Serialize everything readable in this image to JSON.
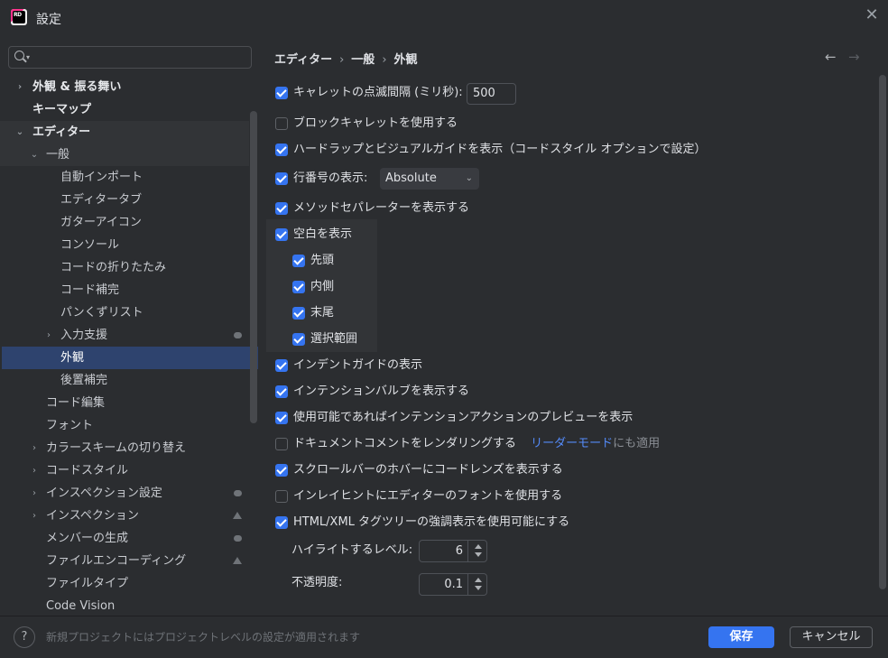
{
  "window": {
    "title": "設定",
    "app_logo_text": "RD"
  },
  "search": {
    "placeholder": ""
  },
  "tree": [
    {
      "label": "外観 & 振る舞い"
    },
    {
      "label": "キーマップ"
    },
    {
      "label": "エディター"
    },
    {
      "label": "一般"
    },
    {
      "label": "自動インポート"
    },
    {
      "label": "エディタータブ"
    },
    {
      "label": "ガターアイコン"
    },
    {
      "label": "コンソール"
    },
    {
      "label": "コードの折りたたみ"
    },
    {
      "label": "コード補完"
    },
    {
      "label": "パンくずリスト"
    },
    {
      "label": "入力支援"
    },
    {
      "label": "外観"
    },
    {
      "label": "後置補完"
    },
    {
      "label": "コード編集"
    },
    {
      "label": "フォント"
    },
    {
      "label": "カラースキームの切り替え"
    },
    {
      "label": "コードスタイル"
    },
    {
      "label": "インスペクション設定"
    },
    {
      "label": "インスペクション"
    },
    {
      "label": "メンバーの生成"
    },
    {
      "label": "ファイルエンコーディング"
    },
    {
      "label": "ファイルタイプ"
    },
    {
      "label": "Code Vision"
    }
  ],
  "breadcrumb": [
    "エディター",
    "一般",
    "外観"
  ],
  "options": {
    "caret_blink": {
      "label": "キャレットの点滅間隔 (ミリ秒):",
      "value": "500",
      "checked": true
    },
    "block_caret": {
      "label": "ブロックキャレットを使用する",
      "checked": false
    },
    "hard_wraps": {
      "label": "ハードラップとビジュアルガイドを表示（コードスタイル オプションで設定）",
      "checked": true
    },
    "line_numbers": {
      "label": "行番号の表示:",
      "value": "Absolute",
      "checked": true
    },
    "method_sep": {
      "label": "メソッドセパレーターを表示する",
      "checked": true
    },
    "whitespace": {
      "label": "空白を表示",
      "checked": true
    },
    "ws_leading": {
      "label": "先頭",
      "checked": true
    },
    "ws_inner": {
      "label": "内側",
      "checked": true
    },
    "ws_trailing": {
      "label": "末尾",
      "checked": true
    },
    "ws_selection": {
      "label": "選択範囲",
      "checked": true
    },
    "indent_guides": {
      "label": "インデントガイドの表示",
      "checked": true
    },
    "intention_bulb": {
      "label": "インテンションバルブを表示する",
      "checked": true
    },
    "intention_preview": {
      "label": "使用可能であればインテンションアクションのプレビューを表示",
      "checked": true
    },
    "render_docs": {
      "label": "ドキュメントコメントをレンダリングする",
      "link": "リーダーモード",
      "link_tail": "にも適用",
      "checked": false
    },
    "scrollbar_lens": {
      "label": "スクロールバーのホバーにコードレンズを表示する",
      "checked": true
    },
    "inlay_font": {
      "label": "インレイヒントにエディターのフォントを使用する",
      "checked": false
    },
    "tag_tree": {
      "label": "HTML/XML タグツリーの強調表示を使用可能にする",
      "checked": true
    },
    "highlight_level": {
      "label": "ハイライトするレベル:",
      "value": "6"
    },
    "opacity": {
      "label": "不透明度:",
      "value": "0.1"
    }
  },
  "footer": {
    "note": "新規プロジェクトにはプロジェクトレベルの設定が適用されます",
    "help_label": "?",
    "save": "保存",
    "cancel": "キャンセル"
  },
  "colors": {
    "accent": "#3574f0",
    "selection": "#2e436e",
    "link": "#548af7",
    "background": "#2b2d30"
  }
}
